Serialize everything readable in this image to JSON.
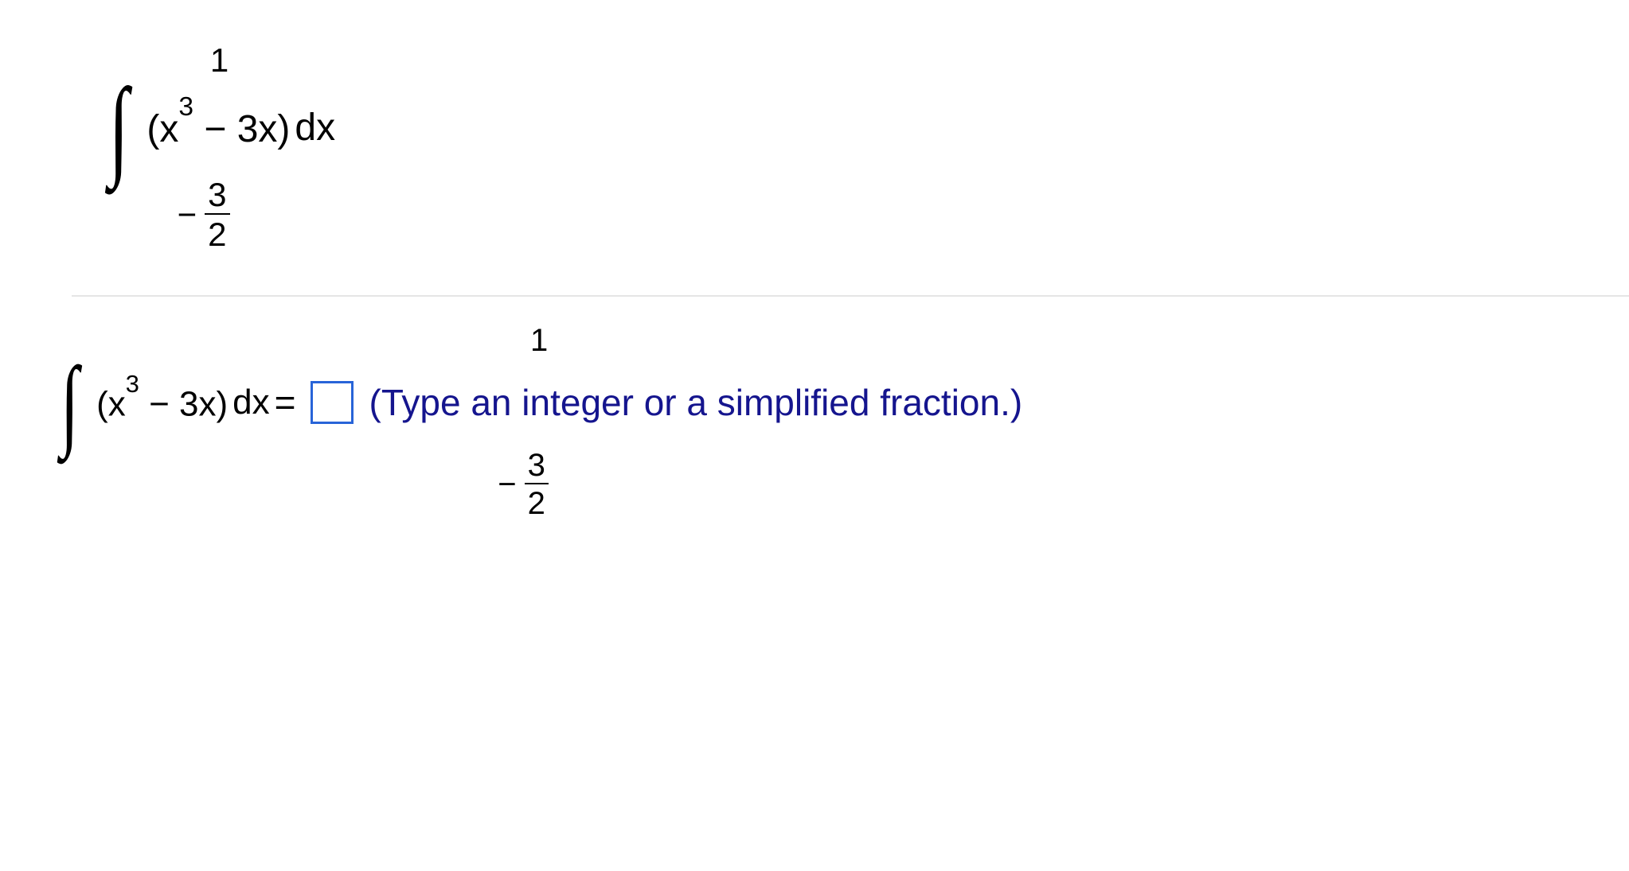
{
  "problem": {
    "upper_limit": "1",
    "lower_limit_sign": "−",
    "lower_limit_num": "3",
    "lower_limit_den": "2",
    "integrand_lparen": "(x",
    "integrand_exp": "3",
    "integrand_minus": " − 3x)",
    "integrand_dx": " dx"
  },
  "answer_row": {
    "upper_limit": "1",
    "lower_limit_sign": "−",
    "lower_limit_num": "3",
    "lower_limit_den": "2",
    "integrand_lparen": "(x",
    "integrand_exp": "3",
    "integrand_minus": " − 3x)",
    "integrand_dx": " dx",
    "equals": " =",
    "hint": "(Type an integer or a simplified fraction.)"
  },
  "colors": {
    "hint_blue": "#15158e",
    "box_blue": "#2864d8",
    "divider_gray": "#e5e5e5"
  }
}
